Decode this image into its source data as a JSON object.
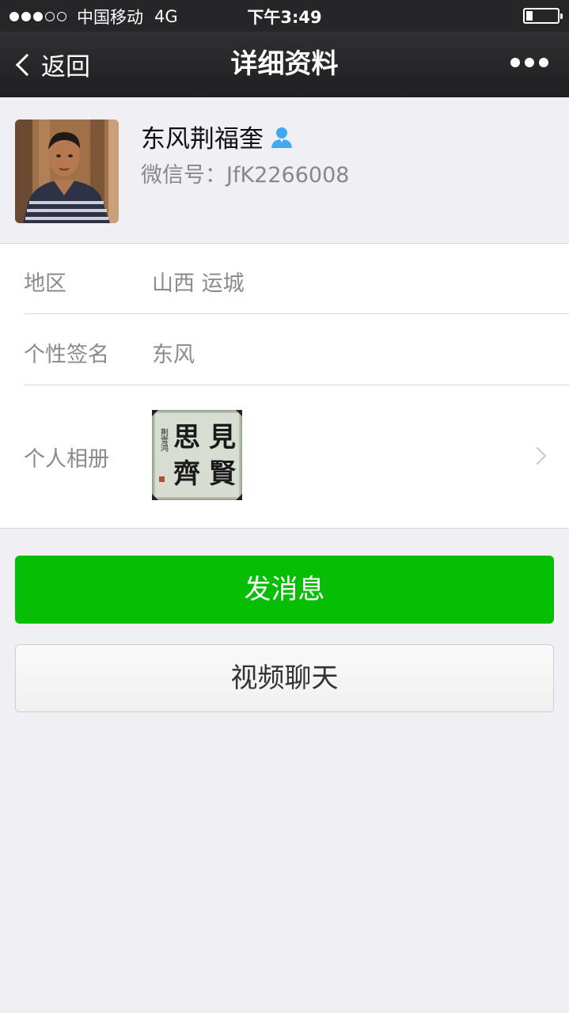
{
  "status_bar": {
    "carrier": "中国移动",
    "network": "4G",
    "time": "下午3:49",
    "signal_bars": 3,
    "signal_total": 5,
    "battery_level": 0.2
  },
  "nav": {
    "back_label": "返回",
    "title": "详细资料",
    "more_icon": "more-dots-icon"
  },
  "profile": {
    "name": "东风荆福奎",
    "wechat_id": "微信号：JfK2266008",
    "badge_icon": "contact-person-icon"
  },
  "info_rows": [
    {
      "label": "地区",
      "value": "山西 运城"
    },
    {
      "label": "个性签名",
      "value": "东风"
    },
    {
      "label": "个人相册",
      "value": ""
    }
  ],
  "album": {
    "calligraphy_text": "見賢思齊",
    "signature": "荆雪鸿"
  },
  "buttons": {
    "send_message": "发消息",
    "video_chat": "视频聊天"
  },
  "colors": {
    "primary_green": "#06be04",
    "nav_bg": "#262629",
    "page_bg": "#efeff4",
    "badge_blue": "#3fa9f5"
  }
}
